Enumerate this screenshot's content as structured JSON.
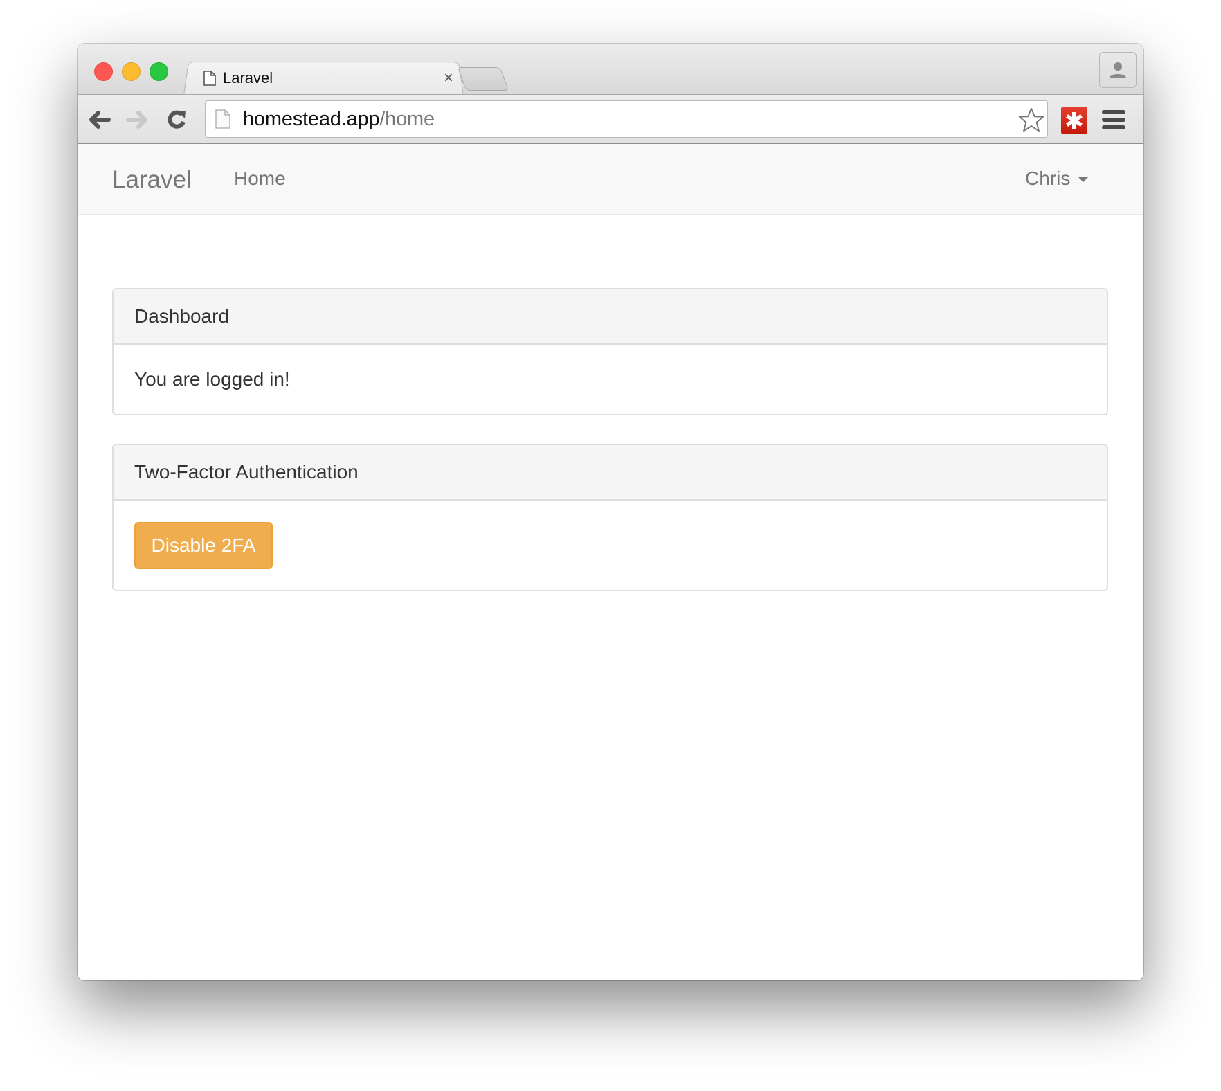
{
  "browser": {
    "tab": {
      "title": "Laravel",
      "close_glyph": "×"
    },
    "url": {
      "host": "homestead.app",
      "path": "/home"
    },
    "icons": {
      "back": "arrow-left-icon",
      "forward": "arrow-right-icon",
      "reload": "reload-icon",
      "bookmark": "star-icon",
      "extension": "lastpass-icon",
      "menu": "hamburger-menu-icon",
      "profile": "person-icon"
    }
  },
  "navbar": {
    "brand": "Laravel",
    "links": [
      {
        "label": "Home"
      }
    ],
    "user": {
      "name": "Chris"
    }
  },
  "panels": [
    {
      "heading": "Dashboard",
      "body": "You are logged in!"
    },
    {
      "heading": "Two-Factor Authentication",
      "button": {
        "label": "Disable 2FA",
        "color": "#f0ad4e"
      }
    }
  ]
}
